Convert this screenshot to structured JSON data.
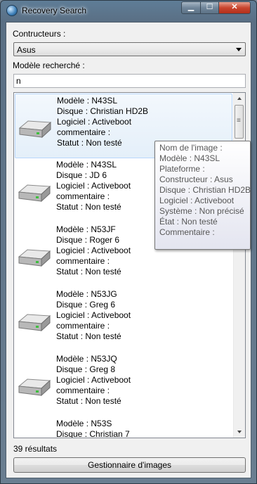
{
  "window": {
    "title": "Recovery Search",
    "controls": {
      "minimize": "▁",
      "maximize": "☐",
      "close": "✕"
    }
  },
  "constructeurs": {
    "label": "Contructeurs :",
    "selected": "Asus"
  },
  "modele": {
    "label": "Modèle recherché :",
    "value": "n"
  },
  "results": [
    {
      "line1": "Modèle : N43SL",
      "line2": "Disque : Christian HD2B",
      "line3": "Logiciel : Activeboot",
      "line4": "commentaire :",
      "line5": "Statut : Non testé"
    },
    {
      "line1": "Modèle : N43SL",
      "line2": "Disque : JD 6",
      "line3": "Logiciel : Activeboot",
      "line4": "commentaire :",
      "line5": "Statut : Non testé"
    },
    {
      "line1": "Modèle : N53JF",
      "line2": "Disque : Roger 6",
      "line3": "Logiciel : Activeboot",
      "line4": "commentaire :",
      "line5": "Statut : Non testé"
    },
    {
      "line1": "Modèle : N53JG",
      "line2": "Disque : Greg 6",
      "line3": "Logiciel : Activeboot",
      "line4": "commentaire :",
      "line5": "Statut : Non testé"
    },
    {
      "line1": "Modèle : N53JQ",
      "line2": "Disque : Greg 8",
      "line3": "Logiciel : Activeboot",
      "line4": "commentaire :",
      "line5": "Statut : Non testé"
    },
    {
      "line1": "Modèle : N53S",
      "line2": "Disque : Christian 7",
      "line3": "",
      "line4": "",
      "line5": ""
    }
  ],
  "tooltip": {
    "l1": "Nom de l'image :",
    "l2": "Modèle : N43SL",
    "l3": "Plateforme :",
    "l4": "Constructeur : Asus",
    "l5": "Disque : Christian HD2B",
    "l6": "Logiciel : Activeboot",
    "l7": "Système : Non précisé",
    "l8": "État : Non testé",
    "l9": "Commentaire :"
  },
  "status": {
    "count": "39 résultats"
  },
  "buttons": {
    "gestionnaire": "Gestionnaire d'images"
  },
  "icons": {
    "app": "globe-icon",
    "item": "hard-disk-icon"
  }
}
